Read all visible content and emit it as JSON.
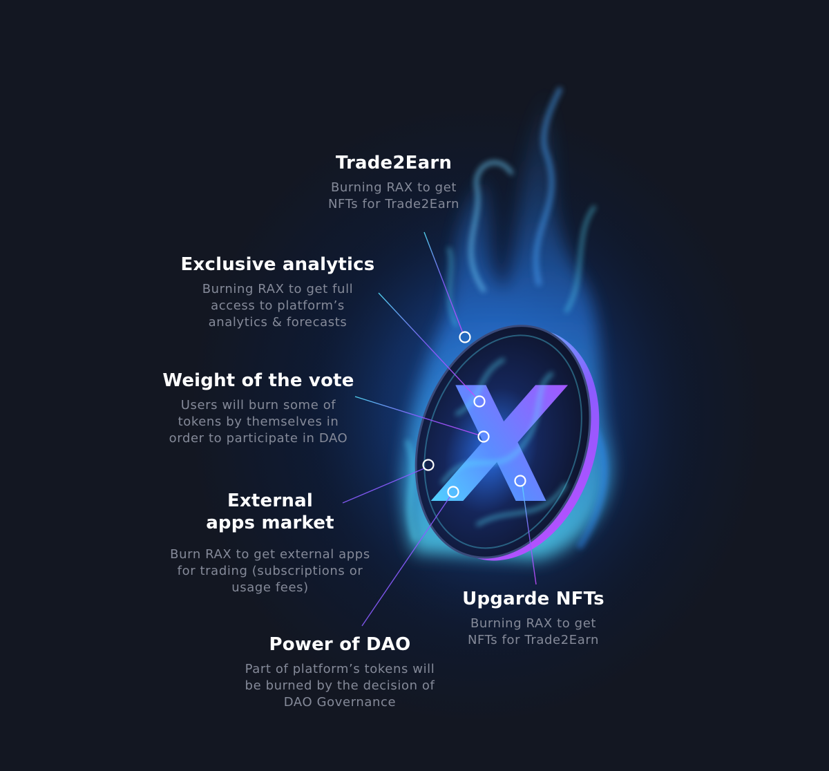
{
  "callouts": [
    {
      "id": "trade2earn",
      "title": "Trade2Earn",
      "lines": [
        "Burning RAX to get",
        "NFTs for Trade2Earn"
      ]
    },
    {
      "id": "exclusive-analytics",
      "title": "Exclusive analytics",
      "lines": [
        "Burning RAX to get full",
        "access to platform’s",
        "analytics & forecasts"
      ]
    },
    {
      "id": "weight-of-vote",
      "title": "Weight of the vote",
      "lines": [
        "Users will burn some of",
        "tokens by themselves in",
        "order to participate in DAO"
      ]
    },
    {
      "id": "external-apps",
      "title_lines": [
        "External",
        "apps market"
      ],
      "lines": [
        "Burn RAX to get external apps",
        "for trading (subscriptions or",
        "usage fees)"
      ]
    },
    {
      "id": "upgrade-nfts",
      "title": "Upgarde NFTs",
      "lines": [
        "Burning RAX to get",
        "NFTs for Trade2Earn"
      ]
    },
    {
      "id": "power-of-dao",
      "title": "Power of DAO",
      "lines": [
        "Part of platform’s tokens will",
        "be burned by the decision of",
        "DAO Governance"
      ]
    }
  ],
  "coin": {
    "letter": "X"
  },
  "colors": {
    "background": "#131722",
    "title": "#ffffff",
    "description": "#858a99",
    "flame_blue": "#2f8bff",
    "flame_cyan": "#57e3ff",
    "coin_purple": "#a24dff",
    "leader_line": "#b77cff"
  }
}
